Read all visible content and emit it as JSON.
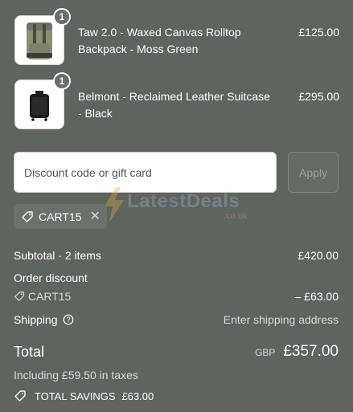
{
  "items": [
    {
      "name": "Taw 2.0 - Waxed Canvas Rolltop Backpack - Moss Green",
      "price": "£125.00",
      "quantity": "1",
      "image": "backpack-moss-green"
    },
    {
      "name": "Belmont - Reclaimed Leather Suitcase - Black",
      "price": "£295.00",
      "quantity": "1",
      "image": "suitcase-black"
    }
  ],
  "discount": {
    "placeholder": "Discount code or gift card",
    "apply_label": "Apply",
    "applied_code": "CART15",
    "remove_symbol": "✕"
  },
  "watermark": {
    "text": "LatestDeals",
    "suffix": ".co.uk"
  },
  "summary": {
    "subtotal_label": "Subtotal · 2 items",
    "subtotal_value": "£420.00",
    "order_discount_label": "Order discount",
    "order_discount_code": "CART15",
    "order_discount_value": "– £63.00",
    "shipping_label": "Shipping",
    "shipping_value": "Enter shipping address",
    "total_label": "Total",
    "total_currency": "GBP",
    "total_value": "£357.00",
    "taxes_note": "Including £59.50 in taxes",
    "savings_label": "TOTAL SAVINGS",
    "savings_value": "£63.00"
  },
  "colors": {
    "background": "#5e645e",
    "text": "#ffffff",
    "muted": "#d9d9d9"
  }
}
